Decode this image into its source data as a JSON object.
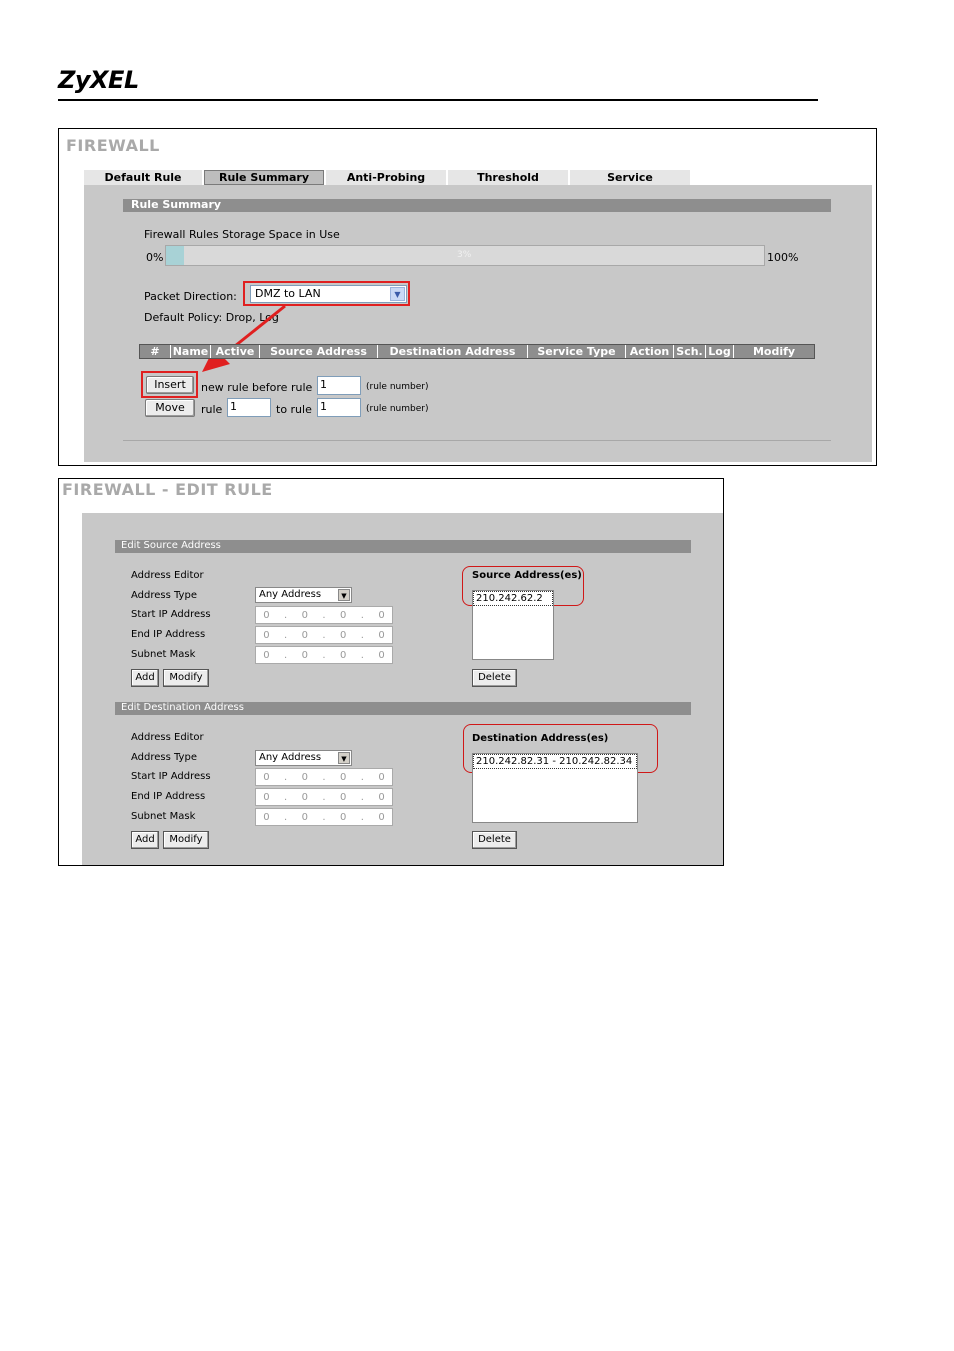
{
  "brand": {
    "logo": "ZyXEL"
  },
  "firewall": {
    "title": "FIREWALL",
    "tabs": [
      {
        "label": "Default Rule",
        "active": false
      },
      {
        "label": "Rule Summary",
        "active": true
      },
      {
        "label": "Anti-Probing",
        "active": false
      },
      {
        "label": "Threshold",
        "active": false
      },
      {
        "label": "Service",
        "active": false
      }
    ],
    "section_title": "Rule Summary",
    "storage": {
      "label": "Firewall Rules Storage Space in Use",
      "min_label": "0%",
      "max_label": "100%",
      "percent_text": "3%",
      "fill_fraction": 0.03
    },
    "packet_direction": {
      "label": "Packet Direction:",
      "value": "DMZ to LAN"
    },
    "default_policy": "Default Policy: Drop, Log",
    "table_headers": [
      "#",
      "Name",
      "Active",
      "Source Address",
      "Destination Address",
      "Service Type",
      "Action",
      "Sch.",
      "Log",
      "Modify"
    ],
    "insert": {
      "button": "Insert",
      "text": "new rule before rule",
      "value": "1",
      "hint": "(rule number)"
    },
    "move": {
      "button": "Move",
      "rule_label": "rule",
      "from_value": "1",
      "to_label": "to rule",
      "to_value": "1",
      "hint": "(rule number)"
    }
  },
  "edit_rule": {
    "title": "FIREWALL - EDIT RULE",
    "source": {
      "section_title": "Edit Source Address",
      "editor_label": "Address Editor",
      "type_label": "Address Type",
      "type_value": "Any Address",
      "start_label": "Start IP Address",
      "end_label": "End IP Address",
      "mask_label": "Subnet Mask",
      "ip_octet": "0",
      "add_button": "Add",
      "modify_button": "Modify",
      "list_label": "Source Address(es)",
      "list_items": [
        "210.242.62.2"
      ],
      "delete_button": "Delete"
    },
    "destination": {
      "section_title": "Edit Destination Address",
      "editor_label": "Address Editor",
      "type_label": "Address Type",
      "type_value": "Any Address",
      "start_label": "Start IP Address",
      "end_label": "End IP Address",
      "mask_label": "Subnet Mask",
      "ip_octet": "0",
      "add_button": "Add",
      "modify_button": "Modify",
      "list_label": "Destination Address(es)",
      "list_items": [
        "210.242.82.31 - 210.242.82.34"
      ],
      "delete_button": "Delete"
    }
  },
  "colors": {
    "annotation_red": "#e02020",
    "section_gray": "#8e8e8e",
    "panel_gray": "#c8c8c8"
  },
  "icons": {
    "dropdown": "chevron-down-icon",
    "arrow": "red-arrow-annotation"
  }
}
